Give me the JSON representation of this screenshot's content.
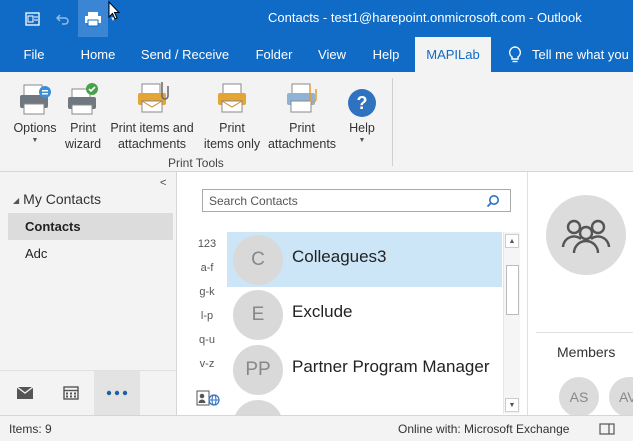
{
  "window": {
    "title": "Contacts - test1@harepoint.onmicrosoft.com  -  Outlook"
  },
  "qat": {
    "icons": [
      "outlook-icon",
      "undo-icon",
      "print-icon",
      "customize-qat-icon"
    ]
  },
  "tabs": [
    {
      "label": "File"
    },
    {
      "label": "Home"
    },
    {
      "label": "Send / Receive"
    },
    {
      "label": "Folder"
    },
    {
      "label": "View"
    },
    {
      "label": "Help"
    },
    {
      "label": "MAPILab"
    }
  ],
  "tell_me": "Tell me what you",
  "ribbon": {
    "buttons": [
      {
        "line1": "Options",
        "line2": "",
        "has_caret": true
      },
      {
        "line1": "Print",
        "line2": "wizard",
        "has_caret": false
      },
      {
        "line1": "Print items and",
        "line2": "attachments",
        "has_caret": false
      },
      {
        "line1": "Print",
        "line2": "items only",
        "has_caret": false
      },
      {
        "line1": "Print",
        "line2": "attachments",
        "has_caret": false
      },
      {
        "line1": "Help",
        "line2": "",
        "has_caret": true
      }
    ],
    "group_label": "Print Tools"
  },
  "nav": {
    "header": "My Contacts",
    "items": [
      {
        "label": "Contacts",
        "selected": true
      },
      {
        "label": "Adc",
        "selected": false
      }
    ],
    "bottom_icons": [
      "mail-icon",
      "calendar-icon",
      "more-icon"
    ]
  },
  "search": {
    "placeholder": "Search Contacts"
  },
  "alpha_index": [
    "123",
    "a-f",
    "g-k",
    "l-p",
    "q-u",
    "v-z"
  ],
  "contacts": [
    {
      "initials": "C",
      "name": "Colleagues3",
      "selected": true
    },
    {
      "initials": "E",
      "name": "Exclude",
      "selected": false
    },
    {
      "initials": "PP",
      "name": "Partner Program Manager",
      "selected": false
    }
  ],
  "reading": {
    "members_label": "Members",
    "members": [
      {
        "initials": "AS"
      },
      {
        "initials": "AV"
      }
    ]
  },
  "status": {
    "items": "Items: 9",
    "connection": "Online with: Microsoft Exchange"
  },
  "colors": {
    "accent": "#0f6bc6",
    "selection": "#cde6f7"
  }
}
